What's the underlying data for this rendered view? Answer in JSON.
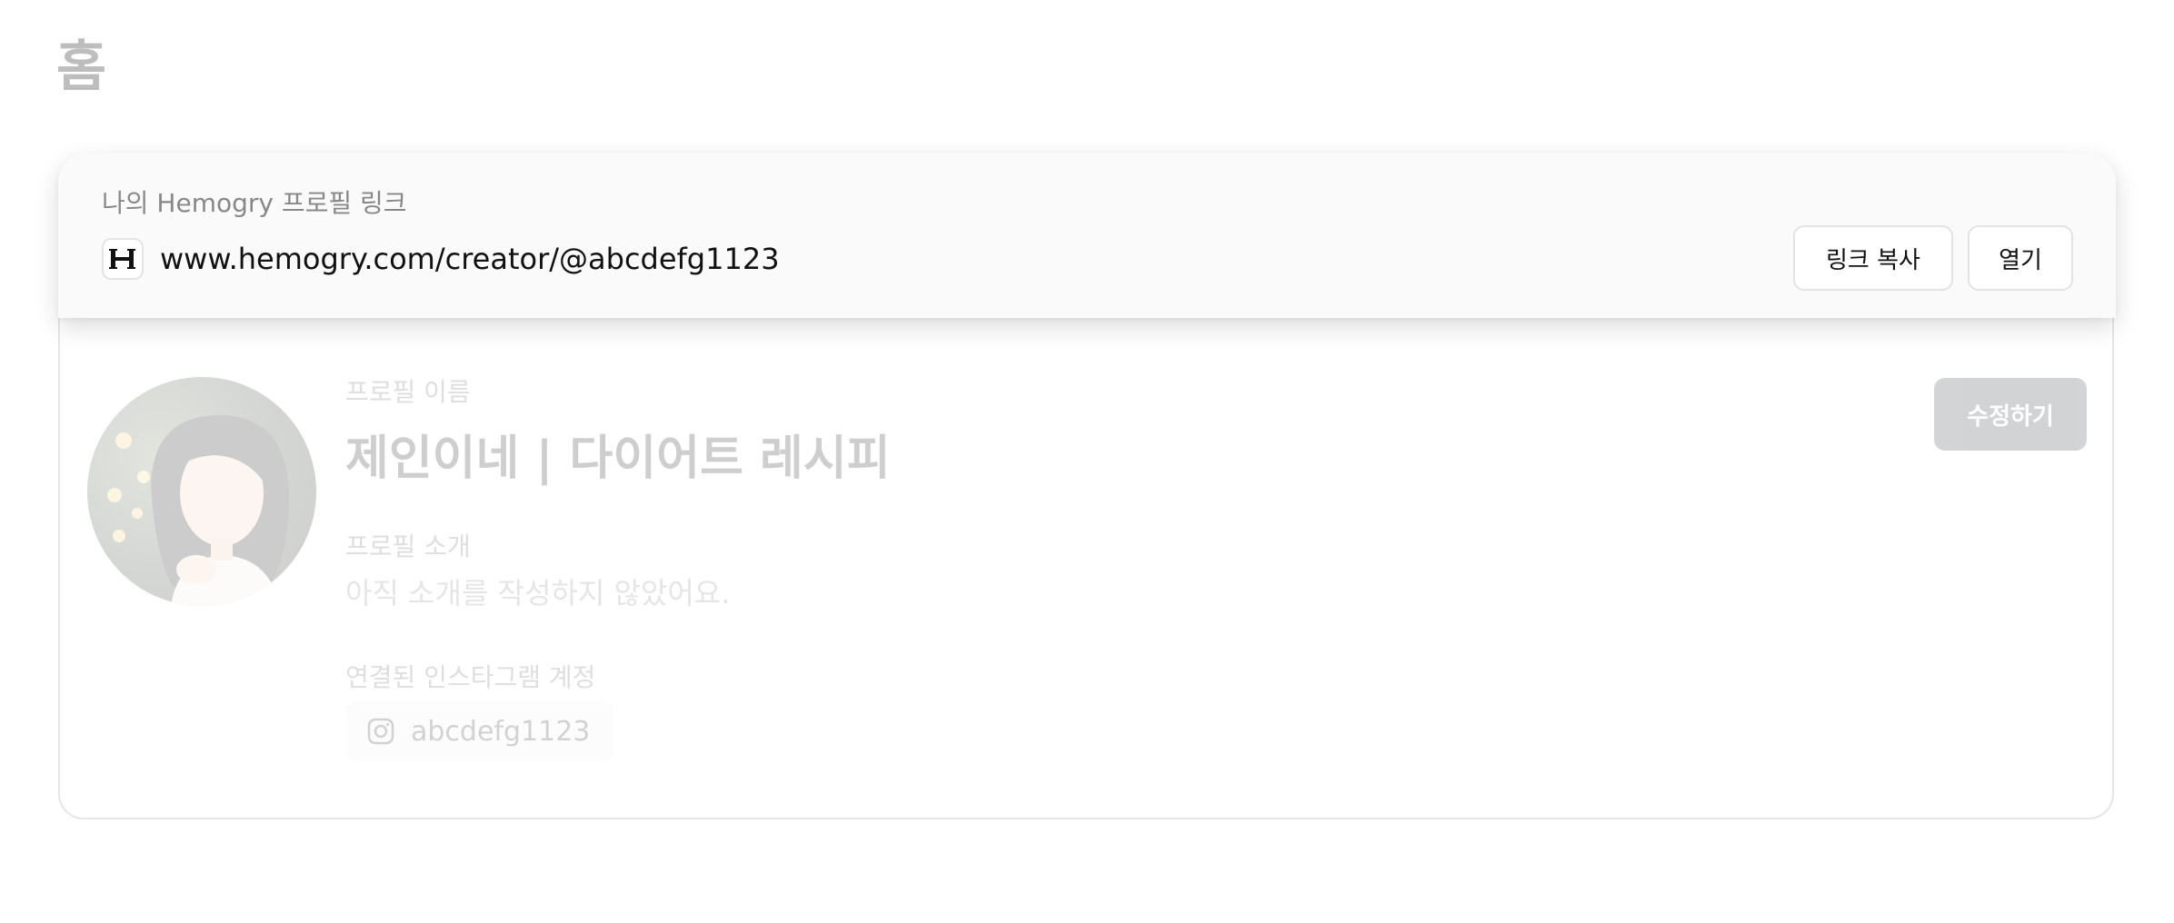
{
  "page": {
    "title": "홈"
  },
  "link_card": {
    "label": "나의 Hemogry 프로필 링크",
    "logo_icon": "hemogry-logo-icon",
    "url": "www.hemogry.com/creator/@abcdefg1123",
    "copy_button": "링크 복사",
    "open_button": "열기"
  },
  "profile": {
    "name_label": "프로필 이름",
    "name": "제인이네 | 다이어트 레시피",
    "bio_label": "프로필 소개",
    "bio_placeholder": "아직 소개를 작성하지 않았어요.",
    "instagram_label": "연결된 인스타그램 계정",
    "instagram_icon": "instagram-icon",
    "instagram_handle": "abcdefg1123",
    "edit_button": "수정하기"
  },
  "colors": {
    "edit_button_bg": "#222a33",
    "card_bg": "#fafafa",
    "title_gray": "#bdbdbd"
  }
}
